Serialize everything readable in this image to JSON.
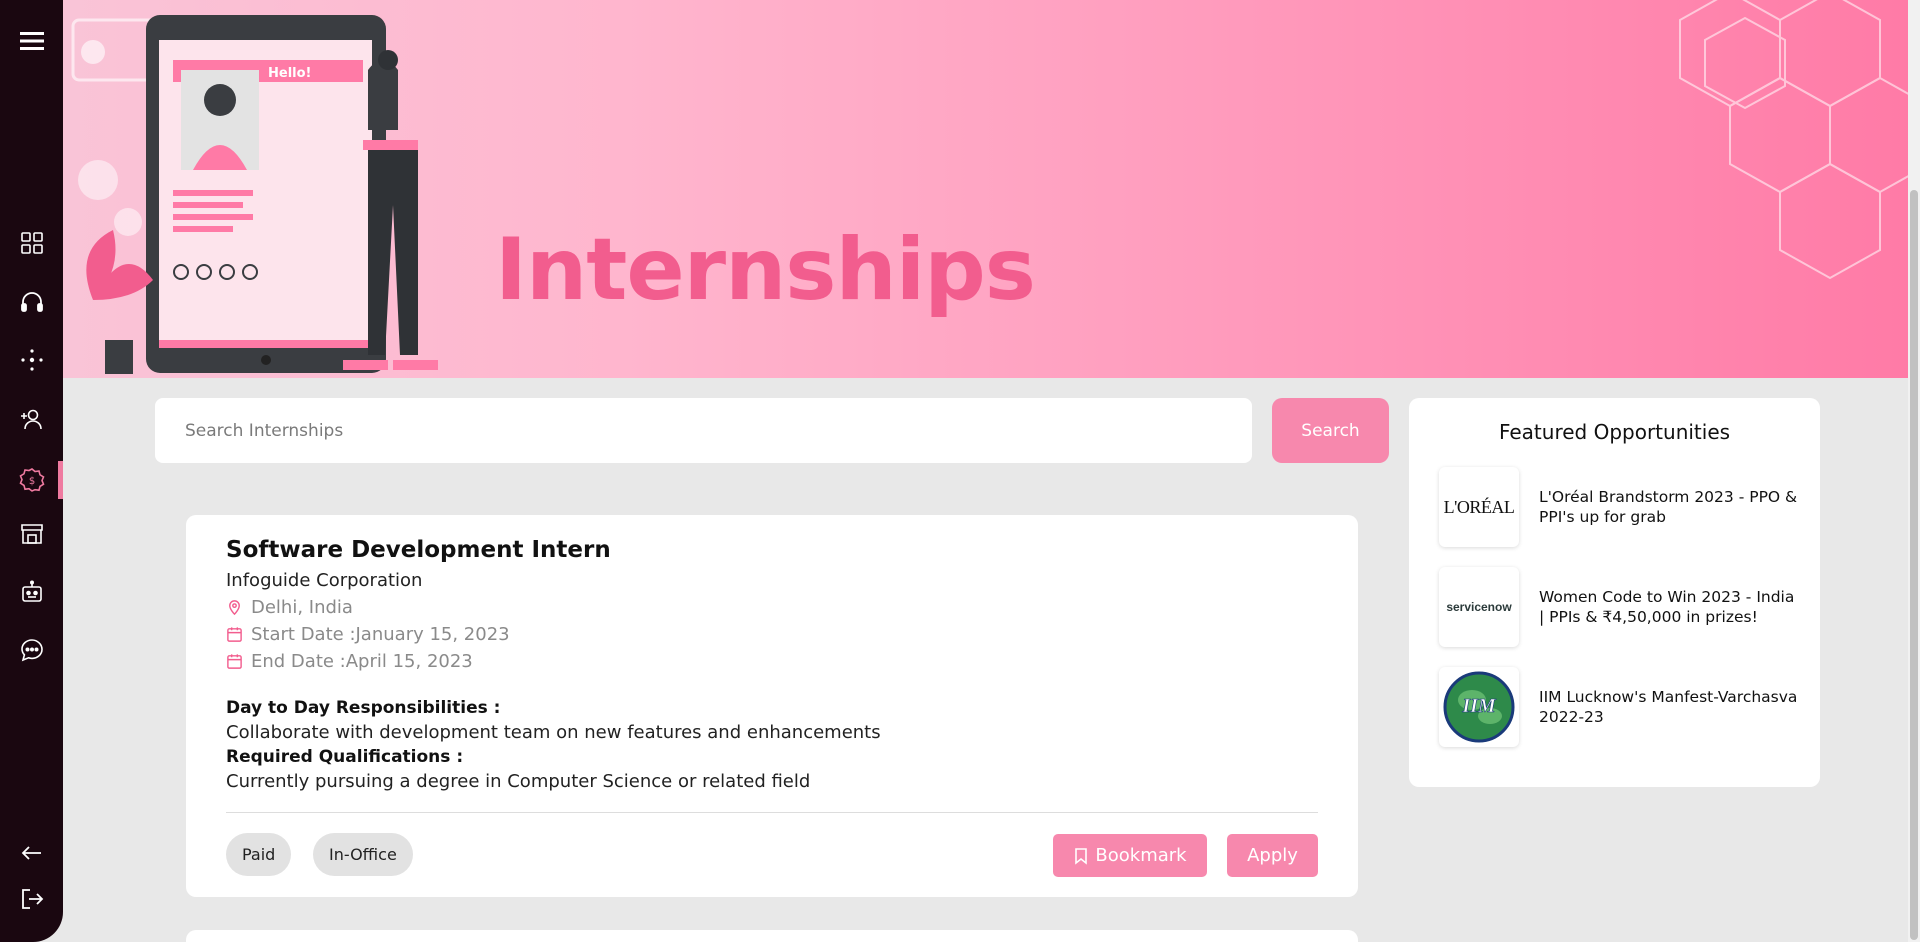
{
  "sidebar": {
    "items": [
      {
        "name": "menu-icon"
      },
      {
        "name": "dashboard-icon"
      },
      {
        "name": "headphones-icon"
      },
      {
        "name": "network-icon"
      },
      {
        "name": "add-user-icon"
      },
      {
        "name": "dollar-gear-icon"
      },
      {
        "name": "store-icon"
      },
      {
        "name": "robot-icon"
      },
      {
        "name": "chat-icon"
      },
      {
        "name": "back-arrow-icon"
      },
      {
        "name": "logout-icon"
      }
    ],
    "active_index": 5
  },
  "banner": {
    "title": "Internships",
    "illustration_text": "Hello!"
  },
  "search": {
    "placeholder": "Search Internships",
    "button_label": "Search"
  },
  "internship": {
    "title": "Software Development Intern",
    "company": "Infoguide Corporation",
    "location": "Delhi, India",
    "start_date": "Start Date :January 15, 2023",
    "end_date": "End Date :April 15, 2023",
    "responsibilities_label": "Day to Day Responsibilities :",
    "responsibilities": "Collaborate with development team on new features and enhancements",
    "qualifications_label": "Required Qualifications :",
    "qualifications": "Currently pursuing a degree in Computer Science or related field",
    "tags": [
      "Paid",
      "In-Office"
    ],
    "bookmark_label": "Bookmark",
    "apply_label": "Apply"
  },
  "featured": {
    "heading": "Featured Opportunities",
    "items": [
      {
        "logo": "L'ORÉAL",
        "text": "L'Oréal Brandstorm 2023 - PPO & PPI's up for grab"
      },
      {
        "logo": "servicenow",
        "text": "Women Code to Win 2023 - India | PPIs & ₹4,50,000 in prizes!"
      },
      {
        "logo": "IIM LUCKNOW",
        "text": "IIM Lucknow's Manfest-Varchasva 2022-23"
      }
    ]
  },
  "colors": {
    "accent": "#f788ad",
    "sidebar": "#1a0710",
    "banner_title": "#f25d8e"
  }
}
